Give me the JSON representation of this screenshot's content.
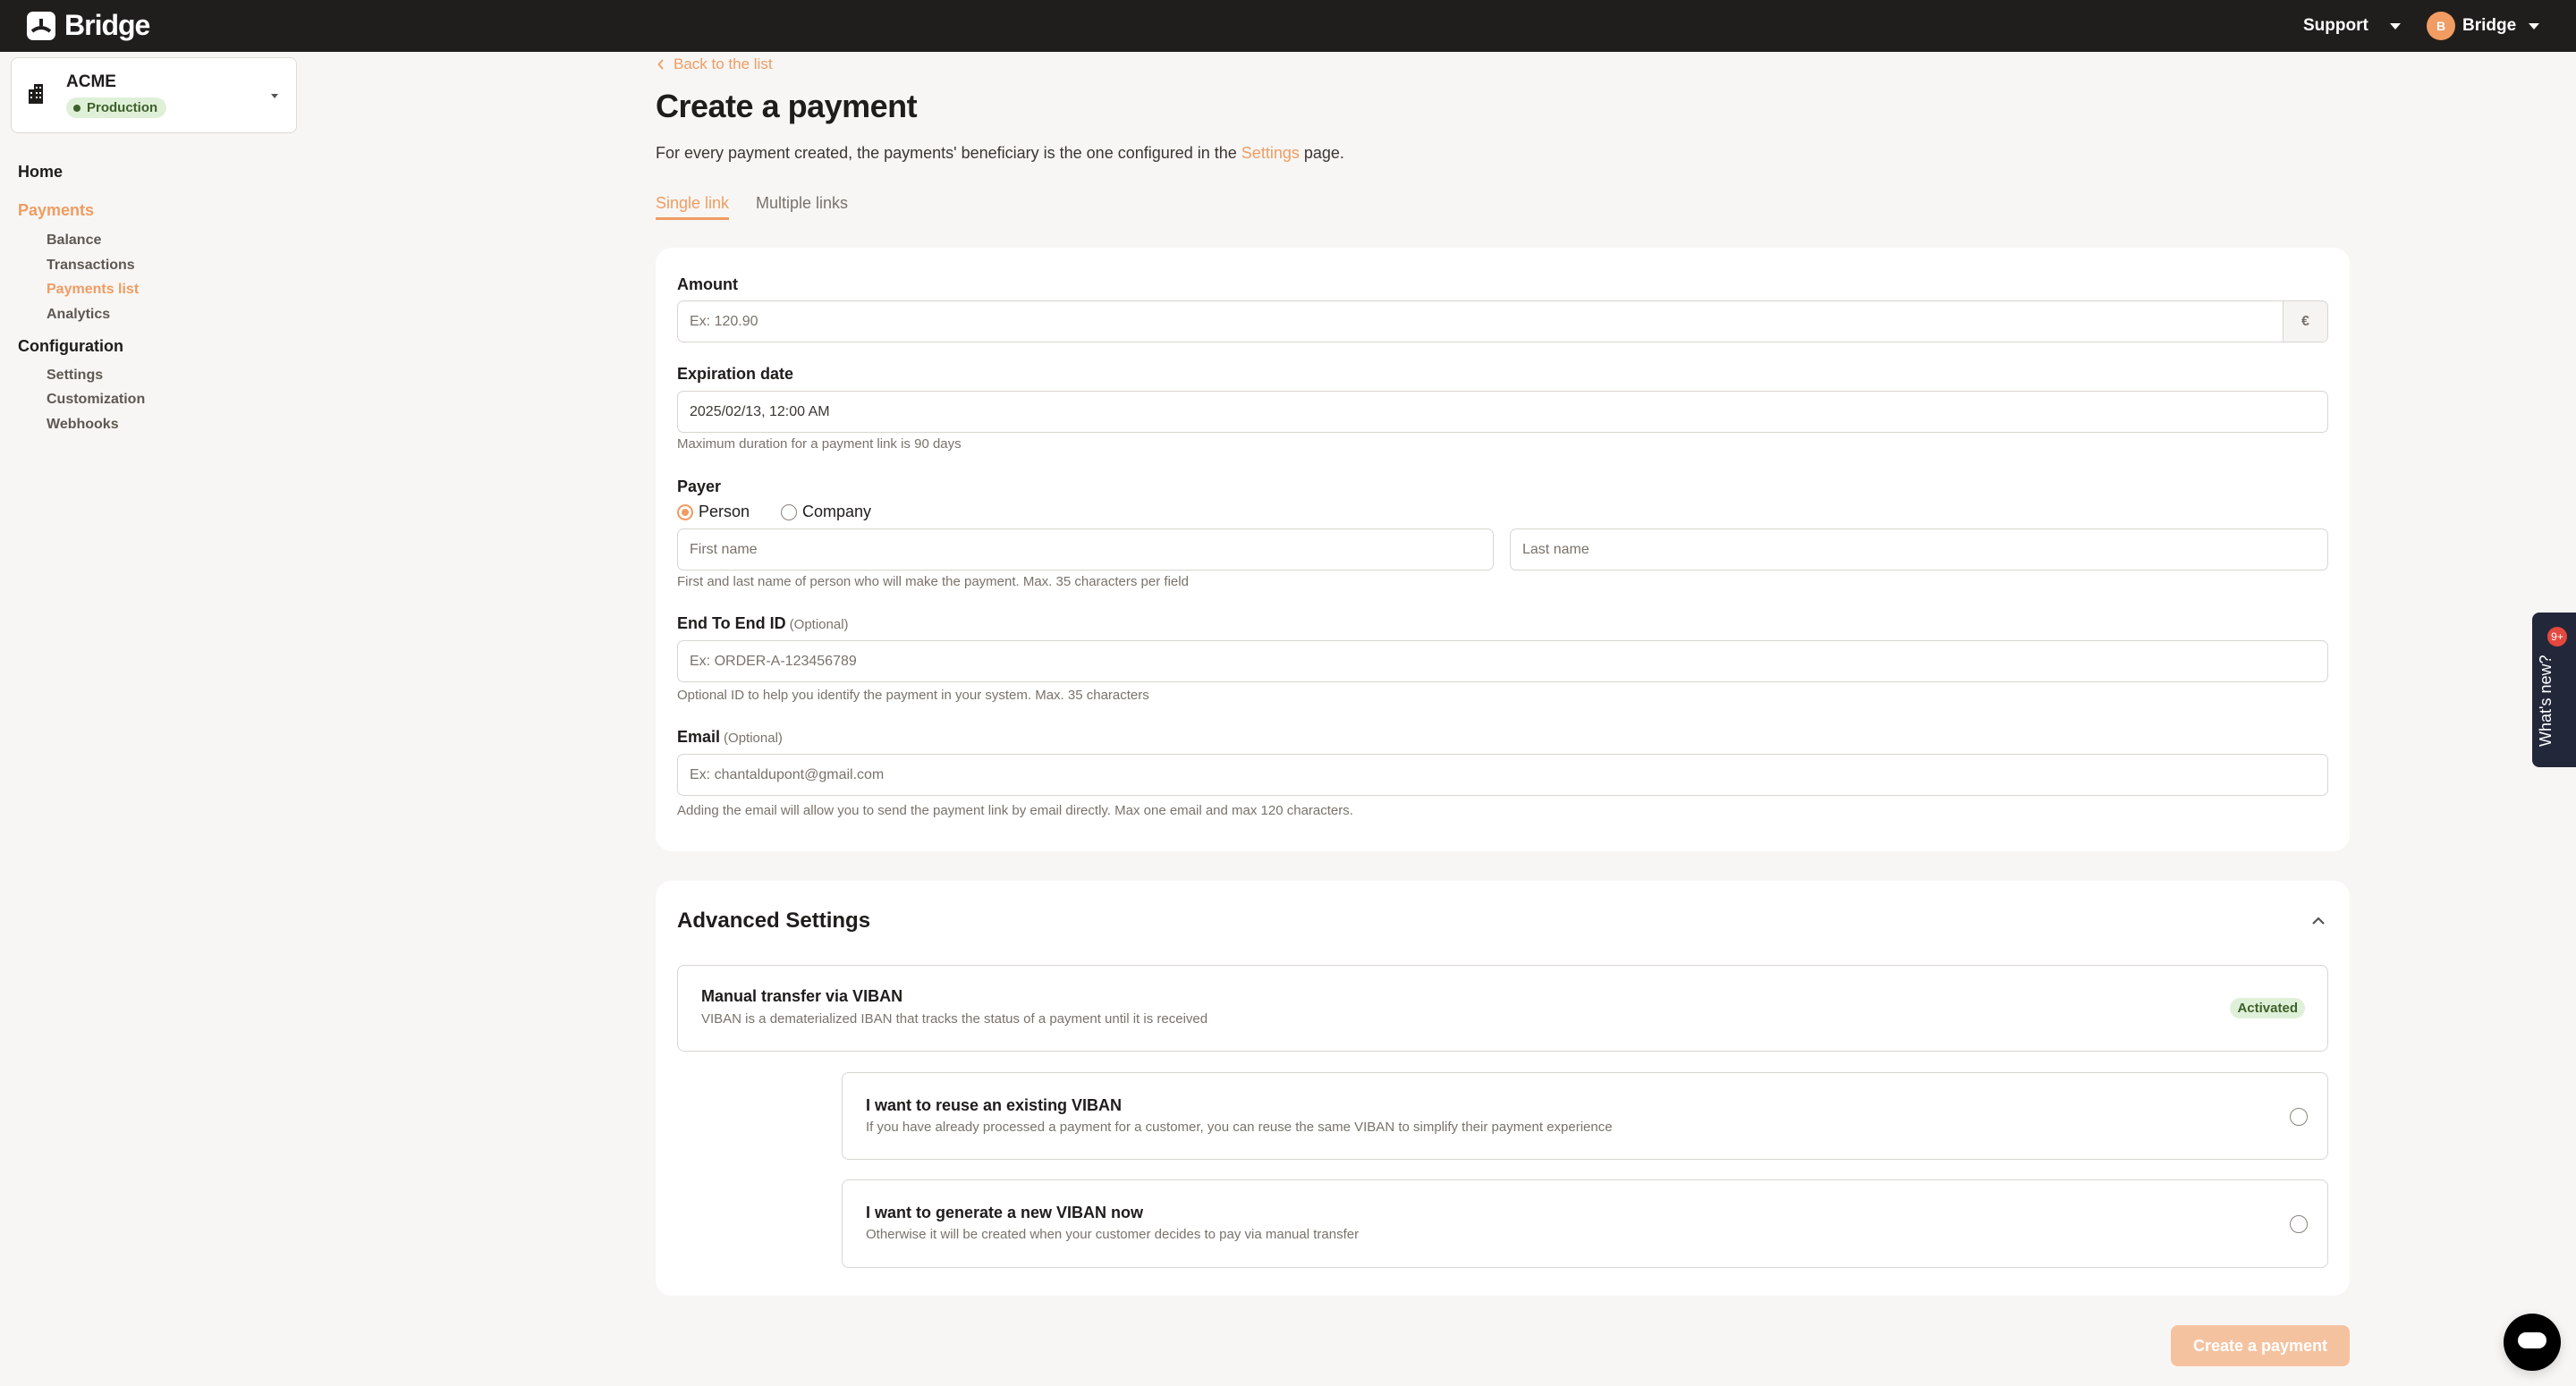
{
  "topbar": {
    "brand": "Bridge",
    "support": "Support",
    "user_initial": "B",
    "user_name": "Bridge"
  },
  "org": {
    "name": "ACME",
    "environment": "Production"
  },
  "sidebar": {
    "home": "Home",
    "payments": "Payments",
    "payments_items": [
      "Balance",
      "Transactions",
      "Payments list",
      "Analytics"
    ],
    "configuration": "Configuration",
    "configuration_items": [
      "Settings",
      "Customization",
      "Webhooks"
    ]
  },
  "page": {
    "back": "Back to the list",
    "title": "Create a payment",
    "desc_before": "For every payment created, the payments' beneficiary is the one configured in the ",
    "desc_link": "Settings",
    "desc_after": " page.",
    "tabs": [
      "Single link",
      "Multiple links"
    ]
  },
  "form": {
    "amount": {
      "label": "Amount",
      "placeholder": "Ex: 120.90",
      "currency": "€"
    },
    "expiration": {
      "label": "Expiration date",
      "value": "2025/02/13, 12:00 AM",
      "help": "Maximum duration for a payment link is 90 days"
    },
    "payer": {
      "label": "Payer",
      "options": [
        "Person",
        "Company"
      ],
      "selected": "Person",
      "first_placeholder": "First name",
      "last_placeholder": "Last name",
      "help": "First and last name of person who will make the payment. Max. 35 characters per field"
    },
    "e2e": {
      "label": "End To End ID",
      "optional": "(Optional)",
      "placeholder": "Ex: ORDER-A-123456789",
      "help": "Optional ID to help you identify the payment in your system. Max. 35 characters"
    },
    "email": {
      "label": "Email",
      "optional": "(Optional)",
      "placeholder": "Ex: chantaldupont@gmail.com",
      "help": "Adding the email will allow you to send the payment link by email directly. Max one email and max 120 characters."
    }
  },
  "advanced": {
    "title": "Advanced Settings",
    "viban": {
      "title": "Manual transfer via VIBAN",
      "desc": "VIBAN is a dematerialized IBAN that tracks the status of a payment until it is received",
      "status": "Activated"
    },
    "options": [
      {
        "title": "I want to reuse an existing VIBAN",
        "desc": "If you have already processed a payment for a customer, you can reuse the same VIBAN to simplify their payment experience"
      },
      {
        "title": "I want to generate a new VIBAN now",
        "desc": "Otherwise it will be created when your customer decides to pay via manual transfer"
      }
    ]
  },
  "submit": "Create a payment",
  "whatsnew": {
    "label": "What's new?",
    "badge": "9+"
  },
  "colors": {
    "accent": "#f09c63",
    "topbar": "#201e1c",
    "success_bg": "#dff0d8",
    "success_text": "#3e5f2a"
  }
}
